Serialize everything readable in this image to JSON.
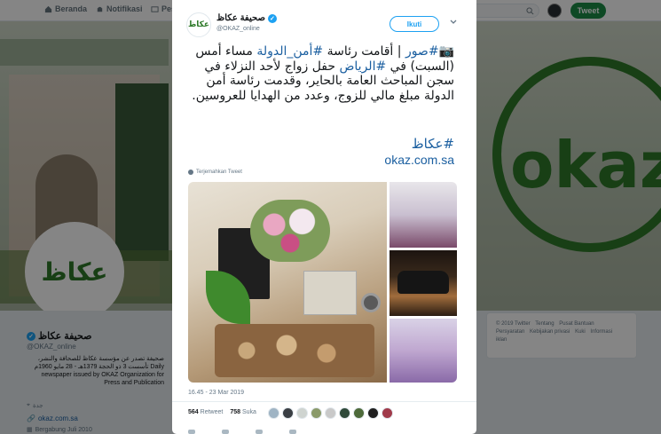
{
  "topnav": {
    "home_label": "Beranda",
    "notifications_label": "Notifikasi",
    "messages_label": "Pes",
    "tweet_button": "Tweet"
  },
  "profile": {
    "name": "صحيفة عكاظ",
    "handle": "@OKAZ_online",
    "bio": "صحيفة تصدر عن مؤسسة عكاظ للصحافة والنشر، تأسست 3 ذو الحجة 1379هـ - 28 مايو 1960م Daily newspaper issued by OKAZ Organization for Press and Publication",
    "location": "جدة",
    "link": "okaz.com.sa",
    "joined": "Bergabung Juli 2010"
  },
  "footer": {
    "links": [
      "© 2019 Twitter",
      "Tentang",
      "Pusat Bantuan",
      "Persyaratan",
      "Kebijakan privasi",
      "Kuki",
      "Informasi iklan"
    ]
  },
  "tweet": {
    "author_name": "صحيفة عكاظ",
    "author_handle": "@OKAZ_online",
    "follow_label": "Ikuti",
    "text_parts": {
      "emoji": "📷",
      "tag1": "#صور",
      "t1": " | أقامت رئاسة ",
      "tag2": "#أمن_الدولة",
      "t2": " مساء أمس (السبت) في ",
      "tag3": "#الرياض",
      "t3": " حفل زواج لأحد النزلاء في سجن المباحث العامة بالحاير، وقدمت رئاسة أمن الدولة مبلغ مالي للزوج، وعدد من الهدايا للعروسين."
    },
    "hashtag": "#عكاظ",
    "url": "okaz.com.sa",
    "translate_label": "Terjemahkan Tweet",
    "timestamp": "16.45 - 23 Mar 2019",
    "retweet_count": "564",
    "retweet_label": "Retweet",
    "like_count": "758",
    "like_label": "Suka"
  },
  "colors": {
    "brand_green": "#1b8c46",
    "link_blue": "#1b5fa0",
    "twitter_blue": "#1da1f2"
  }
}
